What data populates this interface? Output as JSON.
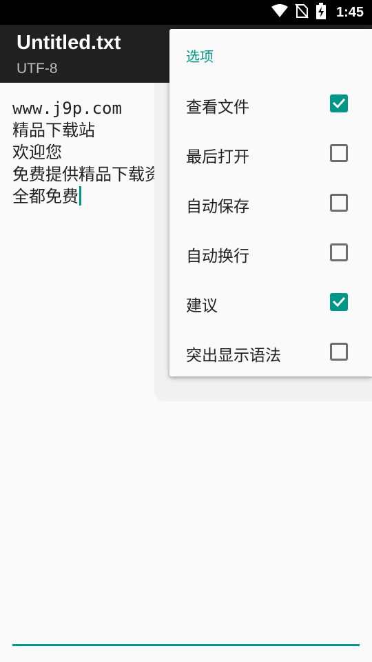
{
  "status_bar": {
    "time": "1:45",
    "icons": [
      "wifi-icon",
      "no-sim-icon",
      "battery-charging-icon"
    ]
  },
  "app_bar": {
    "title": "Untitled.txt",
    "subtitle": "UTF-8"
  },
  "editor": {
    "lines": [
      "www.j9p.com",
      "精品下载站",
      "欢迎您",
      "免费提供精品下载资",
      "全都免费"
    ],
    "accent_color": "#009688"
  },
  "menu": {
    "header": "选项",
    "items": [
      {
        "label": "查看文件",
        "checked": true
      },
      {
        "label": "最后打开",
        "checked": false
      },
      {
        "label": "自动保存",
        "checked": false
      },
      {
        "label": "自动换行",
        "checked": false
      },
      {
        "label": "建议",
        "checked": true
      },
      {
        "label": "突出显示语法",
        "checked": false
      }
    ]
  }
}
